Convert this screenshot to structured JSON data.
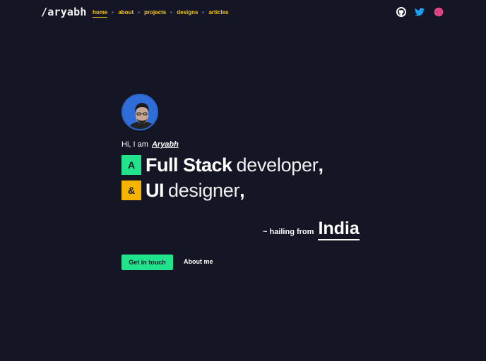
{
  "header": {
    "logo": "/aryabh",
    "nav": [
      {
        "label": "home",
        "active": true
      },
      {
        "label": "about",
        "active": false
      },
      {
        "label": "projects",
        "active": false
      },
      {
        "label": "designs",
        "active": false
      },
      {
        "label": "articles",
        "active": false
      }
    ],
    "social": [
      "github-icon",
      "twitter-icon",
      "dribbble-icon"
    ]
  },
  "hero": {
    "greeting_prefix": "Hi, I am",
    "name": "Aryabh",
    "line1": {
      "badge": "A",
      "strong": "Full Stack",
      "thin": "developer",
      "suffix": ","
    },
    "line2": {
      "badge": "&",
      "strong": "UI",
      "thin": "designer",
      "suffix": ","
    },
    "hailing_text": "~ hailing from",
    "country": "India",
    "cta_primary": "Get in touch",
    "cta_secondary": "About me"
  },
  "colors": {
    "background": "#141625",
    "nav_accent": "#f5c518",
    "green_accent": "#20e38c",
    "yellow_accent": "#f5b400",
    "twitter": "#1da1f2",
    "dribbble": "#ea4c89"
  }
}
